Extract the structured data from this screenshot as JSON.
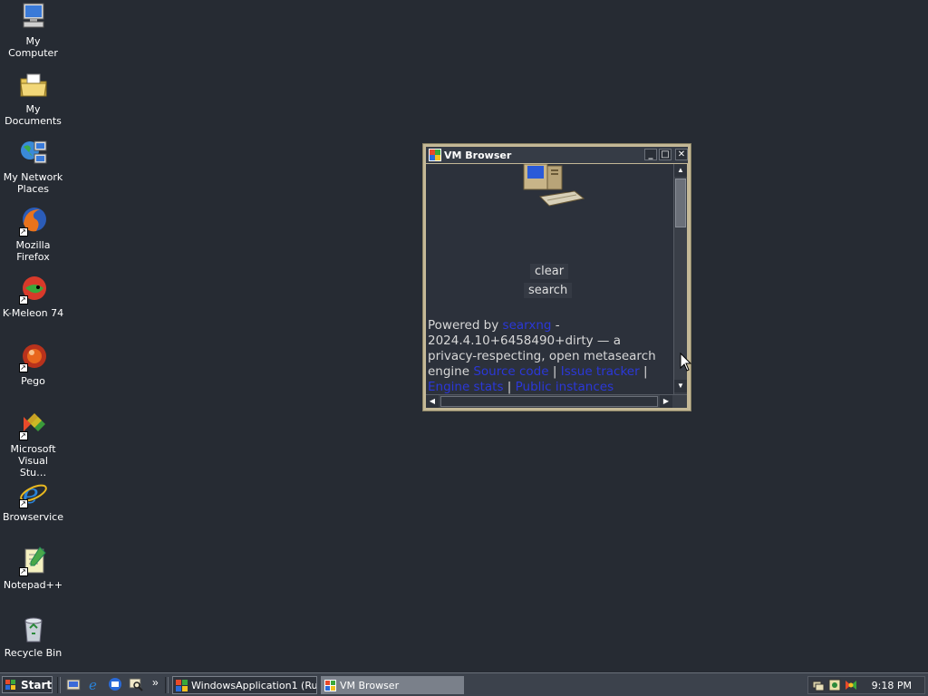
{
  "desktop": {
    "icons": [
      {
        "label": "My Computer",
        "icon": "my-computer-icon"
      },
      {
        "label": "My Documents",
        "icon": "my-documents-icon"
      },
      {
        "label": "My Network Places",
        "icon": "network-places-icon"
      },
      {
        "label": "Mozilla Firefox",
        "icon": "firefox-icon"
      },
      {
        "label": "K-Meleon 74",
        "icon": "k-meleon-icon"
      },
      {
        "label": "Pego",
        "icon": "pego-icon"
      },
      {
        "label": "Microsoft Visual Stu…",
        "icon": "visual-studio-icon"
      },
      {
        "label": "Browservice",
        "icon": "internet-explorer-icon"
      },
      {
        "label": "Notepad++",
        "icon": "notepad-plus-plus-icon"
      },
      {
        "label": "Recycle Bin",
        "icon": "recycle-bin-icon"
      }
    ]
  },
  "window": {
    "title": "VM Browser",
    "buttons": {
      "minimize": "_",
      "maximize": "□",
      "close": "✕"
    },
    "page": {
      "clear_label": "clear",
      "search_label": "search",
      "powered_by": "Powered by",
      "engine_link": "searxng",
      "dash": " -",
      "version_text": "2024.4.10+6458490+dirty — a privacy-respecting, open metasearch engine",
      "links": [
        "Source code",
        "Issue tracker",
        "Engine stats",
        "Public instances"
      ],
      "link_separator": "|"
    }
  },
  "taskbar": {
    "start_label": "Start",
    "chevron": "»",
    "tasks": [
      {
        "label": "WindowsApplication1 (Ru...",
        "active": false
      },
      {
        "label": "VM Browser",
        "active": true
      }
    ],
    "clock": "9:18 PM"
  },
  "colors": {
    "desktop_bg": "#262b33",
    "link": "#2b38d8",
    "window_border": "#c4b896",
    "titlebar": "#363c46"
  }
}
